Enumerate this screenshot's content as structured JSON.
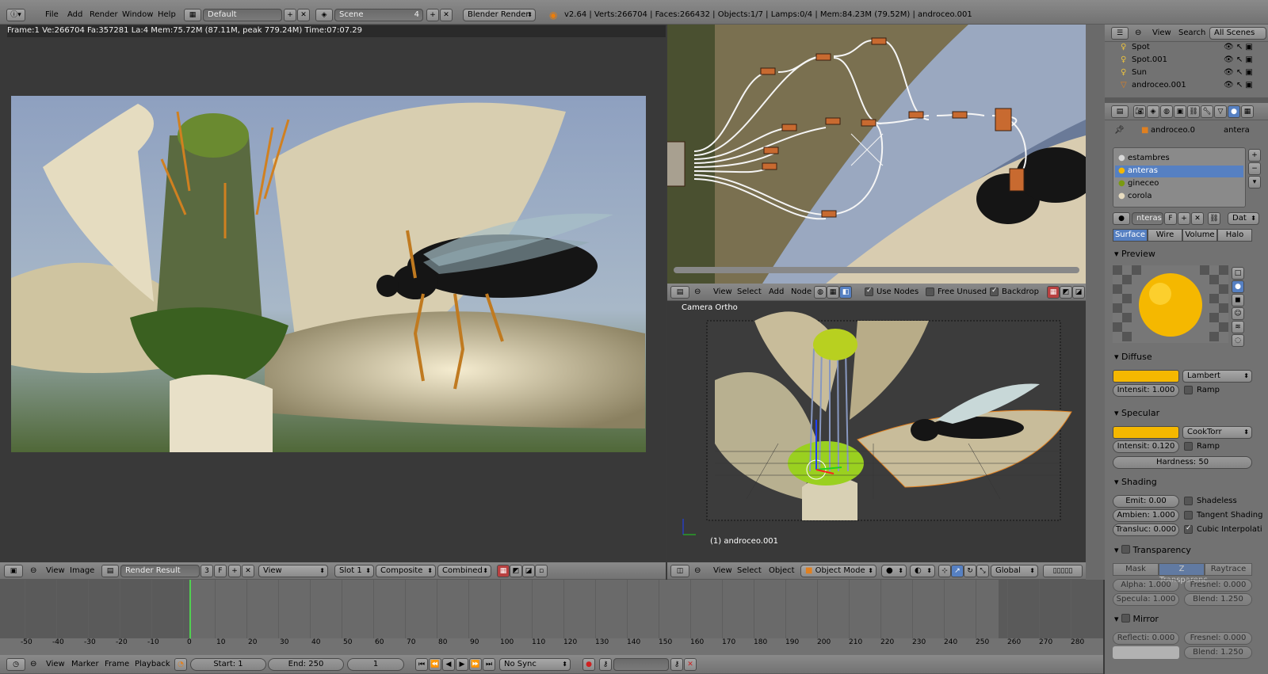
{
  "topbar": {
    "menu": [
      "File",
      "Add",
      "Render",
      "Window",
      "Help"
    ],
    "layout": "Default",
    "scene": "Scene",
    "scene_users": "4",
    "engine": "Blender Render",
    "stats": "v2.64 | Verts:266704 | Faces:266432 | Objects:1/7 | Lamps:0/4 | Mem:84.23M (79.52M) | androceo.001"
  },
  "image_editor": {
    "info": "Frame:1 Ve:266704 Fa:357281 La:4 Mem:75.72M (87.11M, peak 779.24M) Time:07:07.29",
    "menu": [
      "View",
      "Image"
    ],
    "image_name": "Render Result",
    "image_users": "3",
    "fake_user": "F",
    "view": "View",
    "slot": "Slot 1",
    "pass_group": "Composite",
    "pass": "Combined"
  },
  "node_editor": {
    "menu": [
      "View",
      "Select",
      "Add",
      "Node"
    ],
    "use_nodes": "Use Nodes",
    "free_unused": "Free Unused",
    "backdrop": "Backdrop"
  },
  "viewport": {
    "label": "Camera Ortho",
    "object_label": "(1) androceo.001",
    "menu": [
      "View",
      "Select",
      "Object"
    ],
    "mode": "Object Mode",
    "orientation": "Global"
  },
  "outliner": {
    "menu": [
      "View",
      "Search"
    ],
    "scope": "All Scenes",
    "items": [
      "Spot",
      "Spot.001",
      "Sun",
      "androceo.001"
    ]
  },
  "properties": {
    "breadcrumb": [
      "androceo.0",
      "antera"
    ],
    "materials": [
      {
        "name": "estambres",
        "color": "#d8d8d8"
      },
      {
        "name": "anteras",
        "color": "#f5b800"
      },
      {
        "name": "gineceo",
        "color": "#7a9a10"
      },
      {
        "name": "corola",
        "color": "#e8dcc0"
      }
    ],
    "selected_material": "anteras",
    "material_field": "nteras",
    "fake": "F",
    "data": "Dat",
    "tabs": [
      "Surface",
      "Wire",
      "Volume",
      "Halo"
    ],
    "preview_title": "Preview",
    "diffuse_title": "Diffuse",
    "diffuse_color": "#f5b800",
    "diffuse_shader": "Lambert",
    "diffuse_intensity": "Intensit: 1.000",
    "ramp": "Ramp",
    "specular_title": "Specular",
    "specular_color": "#f5b800",
    "specular_shader": "CookTorr",
    "specular_intensity": "Intensit: 0.120",
    "hardness": "Hardness: 50",
    "shading_title": "Shading",
    "emit": "Emit: 0.00",
    "ambient": "Ambien: 1.000",
    "transluc": "Transluc: 0.000",
    "shadeless": "Shadeless",
    "tangent": "Tangent Shading",
    "cubic": "Cubic Interpolati",
    "transparency_title": "Transparency",
    "transp_tabs": [
      "Mask",
      "Z Transparenc",
      "Raytrace"
    ],
    "alpha": "Alpha: 1.000",
    "fresnel": "Fresnel: 0.000",
    "specula": "Specula: 1.000",
    "blend": "Blend: 1.250",
    "mirror_title": "Mirror",
    "reflect": "Reflecti: 0.000",
    "fresnel2": "Fresnel: 0.000",
    "blend2": "Blend: 1.250"
  },
  "timeline": {
    "ticks": [
      "-50",
      "-40",
      "-30",
      "-20",
      "-10",
      "0",
      "10",
      "20",
      "30",
      "40",
      "50",
      "60",
      "70",
      "80",
      "90",
      "100",
      "110",
      "120",
      "130",
      "140",
      "150",
      "160",
      "170",
      "180",
      "190",
      "200",
      "210",
      "220",
      "230",
      "240",
      "250",
      "260",
      "270",
      "280"
    ],
    "menu": [
      "View",
      "Marker",
      "Frame",
      "Playback"
    ],
    "start": "Start: 1",
    "end": "End: 250",
    "current": "1",
    "sync": "No Sync"
  }
}
